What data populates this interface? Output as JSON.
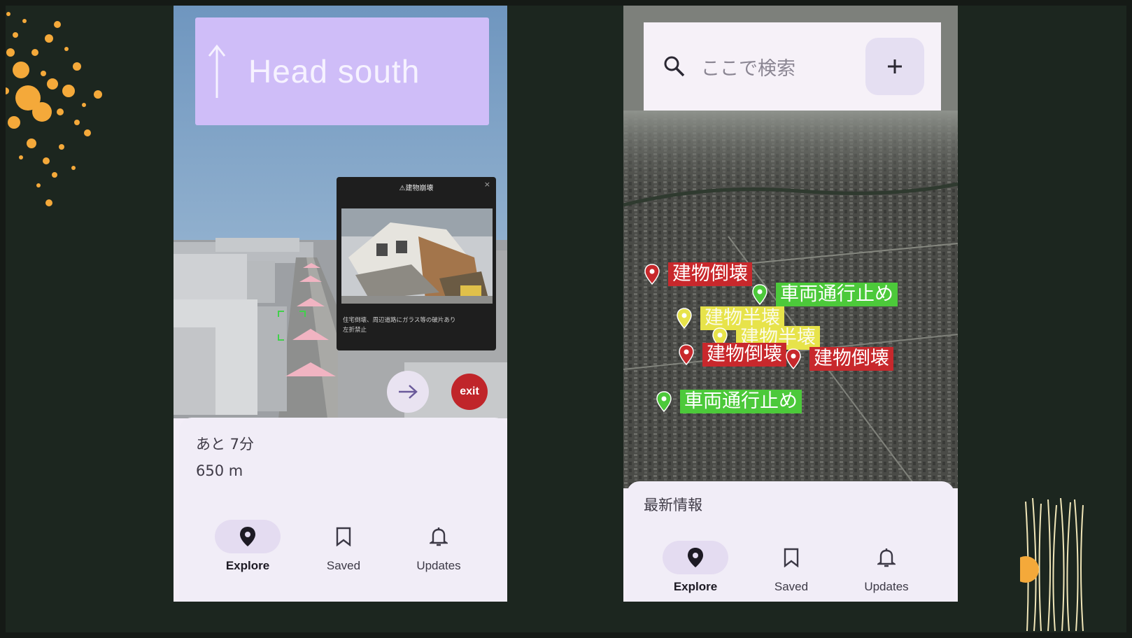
{
  "left_phone": {
    "navigation": {
      "instruction": "Head south",
      "direction_icon": "arrow-up-icon"
    },
    "hazard_popup": {
      "title": "⚠建物崩壊",
      "close_glyph": "×",
      "description_line1": "住宅倒壊、周辺道路にガラス等の破片あり",
      "description_line2": "左折禁止"
    },
    "next_button_icon": "arrow-right-icon",
    "exit_label": "exit",
    "trip": {
      "eta": "あと 7分",
      "distance": "650 m"
    },
    "bottom_nav": [
      {
        "label": "Explore",
        "icon": "location-pin-icon",
        "active": true
      },
      {
        "label": "Saved",
        "icon": "bookmark-icon",
        "active": false
      },
      {
        "label": "Updates",
        "icon": "bell-icon",
        "active": false
      }
    ]
  },
  "right_phone": {
    "search": {
      "placeholder": "ここで検索",
      "add_icon": "plus-icon"
    },
    "map_markers": [
      {
        "label": "建物倒壊",
        "type": "red"
      },
      {
        "label": "車両通行止め",
        "type": "green"
      },
      {
        "label": "建物半壊",
        "type": "yellow"
      },
      {
        "label": "建物半壊",
        "type": "yellow"
      },
      {
        "label": "建物倒壊",
        "type": "red"
      },
      {
        "label": "建物倒壊",
        "type": "red"
      },
      {
        "label": "車両通行止め",
        "type": "green"
      }
    ],
    "latest_info_title": "最新情報",
    "bottom_nav": [
      {
        "label": "Explore",
        "icon": "location-pin-icon",
        "active": true
      },
      {
        "label": "Saved",
        "icon": "bookmark-icon",
        "active": false
      },
      {
        "label": "Updates",
        "icon": "bell-icon",
        "active": false
      }
    ]
  },
  "colors": {
    "slide_background": "#1c261f",
    "nav_banner": "#cfbdf8",
    "exit_button": "#c0252a",
    "accent_orange": "#f4a93a",
    "marker_red": "#c8282c",
    "marker_green": "#4cc93a",
    "marker_yellow": "#e7e34a"
  }
}
